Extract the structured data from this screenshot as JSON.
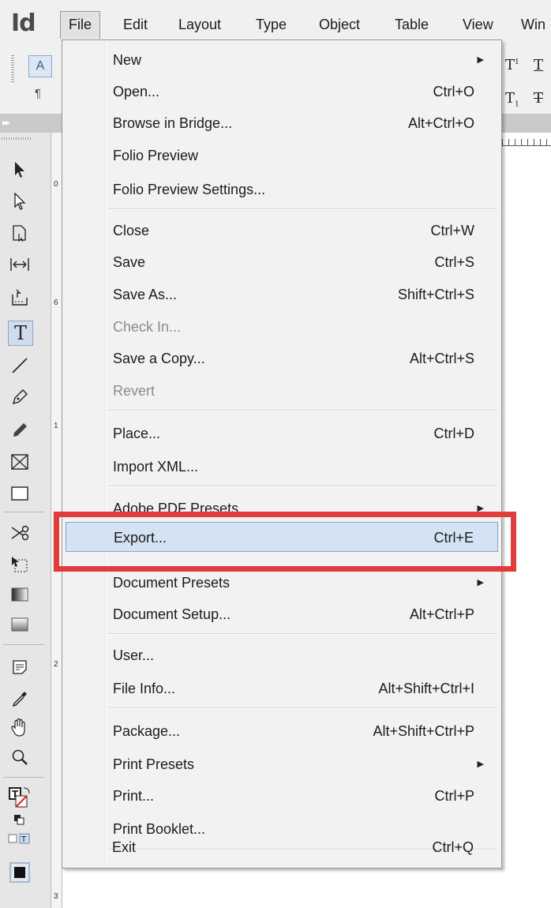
{
  "app": {
    "logo": "Id"
  },
  "menubar": {
    "items": [
      {
        "label": "File",
        "active": true
      },
      {
        "label": "Edit"
      },
      {
        "label": "Layout"
      },
      {
        "label": "Type"
      },
      {
        "label": "Object"
      },
      {
        "label": "Table"
      },
      {
        "label": "View"
      },
      {
        "label": "Win"
      }
    ]
  },
  "control_panel": {
    "char_button": "A",
    "para_button": "¶"
  },
  "rulers": {
    "v_numbers": [
      "0",
      "6",
      "1",
      "2",
      "3"
    ]
  },
  "file_menu": {
    "items": [
      {
        "label": "New",
        "shortcut": "",
        "submenu": true
      },
      {
        "label": "Open...",
        "shortcut": "Ctrl+O"
      },
      {
        "label": "Browse in Bridge...",
        "shortcut": "Alt+Ctrl+O"
      },
      {
        "label": "Folio Preview",
        "shortcut": ""
      },
      {
        "label": "Folio Preview Settings...",
        "shortcut": ""
      },
      {
        "label": "Close",
        "shortcut": "Ctrl+W"
      },
      {
        "label": "Save",
        "shortcut": "Ctrl+S"
      },
      {
        "label": "Save As...",
        "shortcut": "Shift+Ctrl+S"
      },
      {
        "label": "Check In...",
        "shortcut": "",
        "disabled": true
      },
      {
        "label": "Save a Copy...",
        "shortcut": "Alt+Ctrl+S"
      },
      {
        "label": "Revert",
        "shortcut": "",
        "disabled": true
      },
      {
        "label": "Place...",
        "shortcut": "Ctrl+D"
      },
      {
        "label": "Import XML...",
        "shortcut": ""
      },
      {
        "label": "Adobe PDF Presets",
        "shortcut": "",
        "submenu": true
      },
      {
        "label": "Export...",
        "shortcut": "Ctrl+E",
        "highlighted": true
      },
      {
        "label": "Document Presets",
        "shortcut": "",
        "submenu": true
      },
      {
        "label": "Document Setup...",
        "shortcut": "Alt+Ctrl+P"
      },
      {
        "label": "User...",
        "shortcut": ""
      },
      {
        "label": "File Info...",
        "shortcut": "Alt+Shift+Ctrl+I"
      },
      {
        "label": "Package...",
        "shortcut": "Alt+Shift+Ctrl+P"
      },
      {
        "label": "Print Presets",
        "shortcut": "",
        "submenu": true
      },
      {
        "label": "Print...",
        "shortcut": "Ctrl+P"
      },
      {
        "label": "Print Booklet...",
        "shortcut": ""
      },
      {
        "label": "Exit",
        "shortcut": "Ctrl+Q"
      }
    ]
  },
  "colors": {
    "highlight_bg": "#d3e3f4",
    "callout": "#e23b3b"
  }
}
